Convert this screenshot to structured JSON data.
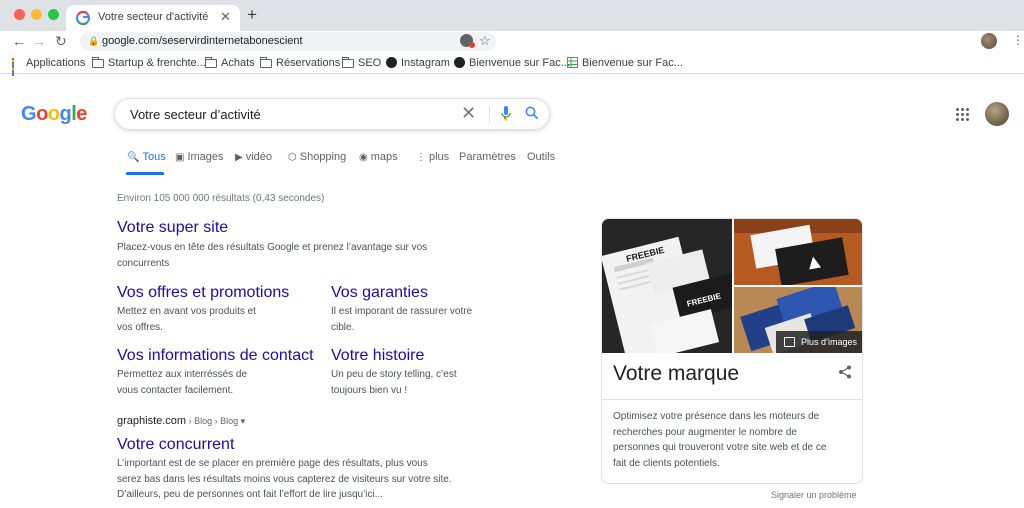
{
  "browser": {
    "tab_title": "Votre secteur d'activité - Rec",
    "tab_close": "✕",
    "new_tab": "+",
    "back": "←",
    "forward": "→",
    "reload": "↻",
    "url": "google.com/seservirdinternetabonescient",
    "star": "☆",
    "menu": "⋮",
    "traffic_colors": [
      "#ff5f57",
      "#febc2e",
      "#28c840"
    ],
    "bookmarks": [
      {
        "label": "Applications",
        "icon": "apps-grid-icon"
      },
      {
        "label": "Startup & frenchte...",
        "icon": "folder-icon"
      },
      {
        "label": "Achats",
        "icon": "folder-icon"
      },
      {
        "label": "Réservations",
        "icon": "folder-icon"
      },
      {
        "label": "SEO",
        "icon": "folder-icon"
      },
      {
        "label": "Instagram",
        "icon": "globe-icon"
      },
      {
        "label": "Bienvenue sur Fac...",
        "icon": "globe-icon"
      },
      {
        "label": "Bienvenue sur Fac...",
        "icon": "sheet-icon"
      }
    ]
  },
  "google": {
    "logo_letters": [
      {
        "ch": "G",
        "color": "#4285f4"
      },
      {
        "ch": "o",
        "color": "#ea4335"
      },
      {
        "ch": "o",
        "color": "#fbbc05"
      },
      {
        "ch": "g",
        "color": "#4285f4"
      },
      {
        "ch": "l",
        "color": "#34a853"
      },
      {
        "ch": "e",
        "color": "#ea4335"
      }
    ],
    "query": "Votre secteur d’activité",
    "clear": "✕",
    "tabs": [
      {
        "label": "Tous",
        "icon": "🔍",
        "active": true
      },
      {
        "label": "Images",
        "icon": "▣"
      },
      {
        "label": "vidéo",
        "icon": "▶"
      },
      {
        "label": "Shopping",
        "icon": "⬡"
      },
      {
        "label": "maps",
        "icon": "◉"
      },
      {
        "label": "plus",
        "icon": "⋮"
      },
      {
        "label": "Paramètres"
      },
      {
        "label": "Outils"
      }
    ],
    "stats": "Environ 105 000 000 résultats (0,43 secondes)"
  },
  "results": {
    "main": {
      "title": "Votre super site",
      "desc": [
        "Placez-vous en tête des résultats Google et prenez l’avantage sur vos",
        "concurrents"
      ]
    },
    "sitelinks": [
      {
        "title": "Vos offres et promotions",
        "desc": [
          "Mettez en avant vos produits et",
          "vos offres."
        ]
      },
      {
        "title": "Vos garanties",
        "desc": [
          "Il est imporant de rassurer votre",
          "cible."
        ]
      },
      {
        "title": "Vos informations de contact",
        "desc": [
          "Permettez aux interréssés de",
          "vous contacter facilement."
        ]
      },
      {
        "title": "Votre histoire",
        "desc": [
          "Un peu de story telling, c’est",
          "toujours bien vu !"
        ]
      }
    ],
    "second": {
      "domain": "graphiste.com",
      "path": " › Blog › Blog ▾",
      "title": "Votre concurrent",
      "desc": [
        "L’important est de se placer en première page des résultats, plus vous",
        "serez bas dans les résultats moins vous capterez de visiteurs sur votre site.",
        "D’ailleurs, peu de personnes ont fait l’effort de lire jusqu’ici..."
      ]
    }
  },
  "knowledge_panel": {
    "image_brand_text": "FREEBIE",
    "more_images": "Plus d’images",
    "title": "Votre marque",
    "description": [
      "Optimisez votre présence dans les moteurs de",
      "recherches pour augmenter le nombre de",
      "personnes qui trouveront votre site web et de ce",
      "fait de clients potentiels."
    ],
    "report": "Signaler un problème"
  }
}
